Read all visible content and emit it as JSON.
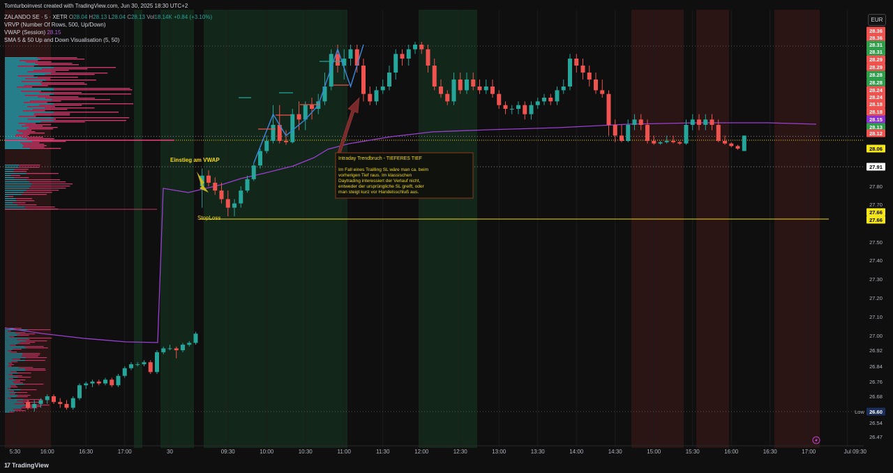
{
  "credit": "Tomturboinvest created with TradingView.com, Jun 30, 2025 18:30 UTC+2",
  "symbol_line": {
    "name": "ZALANDO SE · 5 · XETR",
    "o_label": "O",
    "o": "28.04",
    "h_label": "H",
    "h": "28.13",
    "l_label": "L",
    "l": "28.04",
    "c_label": "C",
    "c": "28.13",
    "vol_label": "Vol",
    "vol": "18.14K",
    "change": "+0.84 (+3.10%)"
  },
  "indicators": [
    {
      "label": "VRVP (Number Of Rows, 500, Up/Down)",
      "value": ""
    },
    {
      "label": "VWAP (Session)",
      "value": "28.15"
    },
    {
      "label": "SMA 5 & 50 Up and Down Visualisation (5, 50)",
      "value": ""
    }
  ],
  "currency": "EUR",
  "brand": "TradingView",
  "brand_logo": "17",
  "colors": {
    "up": "#26a69a",
    "down": "#ef5350",
    "vwap": "#9c3fd1",
    "vp_up": "#26c6da",
    "vp_down": "#ec407a",
    "annotation": "#f5d90a",
    "bg_green": "#13261a",
    "bg_red": "#2a1414",
    "sl_line": "#f5d90a"
  },
  "annotations": {
    "entry": "Einstieg am VWAP",
    "stoploss": "StopLoss",
    "box_title": "Intraday Trendbruch - TIEFERES TIEF",
    "box_text": "Im Fall eines Trailling SL wäre man ca. beim vorherigen Tief raus. Im klassischen Daytrading interessiert der Verlauf nicht, entweder der ursprüngliche SL greift, oder man steigt kurz vor Handelsschluß aus."
  },
  "chart_data": {
    "type": "candlestick",
    "symbol": "ZALANDO SE",
    "interval": "5",
    "exchange": "XETR",
    "y_ticks": [
      "28.36",
      "28.36",
      "28.31",
      "28.31",
      "28.29",
      "28.29",
      "28.28",
      "28.28",
      "28.24",
      "28.24",
      "28.18",
      "28.18",
      "28.15",
      "28.13",
      "28.12",
      "28.06",
      "27.91",
      "27.80",
      "27.70",
      "27.66",
      "27.66",
      "27.50",
      "27.40",
      "27.30",
      "27.20",
      "27.10",
      "27.00",
      "26.92",
      "26.84",
      "26.76",
      "26.68",
      "26.60",
      "26.54",
      "26.47"
    ],
    "y_tick_values": [
      28.36,
      28.36,
      28.31,
      28.31,
      28.29,
      28.29,
      28.28,
      28.28,
      28.24,
      28.24,
      28.18,
      28.18,
      28.15,
      28.13,
      28.12,
      28.06,
      27.91,
      27.8,
      27.7,
      27.66,
      27.66,
      27.5,
      27.4,
      27.3,
      27.2,
      27.1,
      27.0,
      26.92,
      26.84,
      26.76,
      26.68,
      26.6,
      26.54,
      26.47
    ],
    "y_tick_styles": [
      "down",
      "down",
      "up",
      "up",
      "down",
      "down",
      "up",
      "up",
      "down",
      "down",
      "down",
      "down",
      "vwap",
      "up",
      "down",
      "yellow",
      "white",
      "plain",
      "plain",
      "yellow",
      "yellow",
      "plain",
      "plain",
      "plain",
      "plain",
      "plain",
      "plain",
      "plain",
      "plain",
      "plain",
      "plain",
      "low",
      "plain",
      "plain"
    ],
    "low_label": "Low",
    "x_ticks": [
      "5:30",
      "16:00",
      "16:30",
      "17:00",
      "30",
      "09:30",
      "10:00",
      "10:30",
      "11:00",
      "11:30",
      "12:00",
      "12:30",
      "13:00",
      "13:30",
      "14:00",
      "14:30",
      "15:00",
      "15:30",
      "16:00",
      "16:30",
      "17:00",
      "Jul",
      "09:30"
    ],
    "x_tick_index": [
      -2,
      3,
      9,
      15,
      22,
      31,
      37,
      43,
      49,
      55,
      61,
      67,
      73,
      79,
      85,
      91,
      97,
      103,
      109,
      115,
      121,
      127,
      133
    ],
    "ohlc": [
      [
        26.65,
        26.66,
        26.61,
        26.62
      ],
      [
        26.62,
        26.66,
        26.6,
        26.64
      ],
      [
        26.64,
        26.67,
        26.62,
        26.66
      ],
      [
        26.66,
        26.69,
        26.64,
        26.68
      ],
      [
        26.68,
        26.69,
        26.64,
        26.65
      ],
      [
        26.65,
        26.67,
        26.62,
        26.64
      ],
      [
        26.64,
        26.66,
        26.61,
        26.62
      ],
      [
        26.62,
        26.68,
        26.61,
        26.67
      ],
      [
        26.67,
        26.75,
        26.66,
        26.74
      ],
      [
        26.74,
        26.76,
        26.72,
        26.75
      ],
      [
        26.75,
        26.77,
        26.73,
        26.76
      ],
      [
        26.76,
        26.77,
        26.74,
        26.75
      ],
      [
        26.75,
        26.78,
        26.74,
        26.77
      ],
      [
        26.77,
        26.78,
        26.73,
        26.74
      ],
      [
        26.74,
        26.8,
        26.73,
        26.79
      ],
      [
        26.79,
        26.84,
        26.78,
        26.83
      ],
      [
        26.83,
        26.86,
        26.82,
        26.85
      ],
      [
        26.85,
        26.86,
        26.84,
        26.85
      ],
      [
        26.85,
        26.87,
        26.84,
        26.86
      ],
      [
        26.86,
        26.87,
        26.8,
        26.81
      ],
      [
        26.81,
        26.92,
        26.8,
        26.91
      ],
      [
        26.91,
        26.94,
        26.9,
        26.93
      ],
      [
        26.93,
        26.95,
        26.92,
        26.93
      ],
      [
        26.93,
        26.94,
        26.88,
        26.92
      ],
      [
        26.92,
        26.96,
        26.91,
        26.95
      ],
      [
        26.95,
        26.97,
        26.94,
        26.96
      ],
      [
        26.96,
        27.02,
        26.95,
        27.01
      ],
      [
        27.8,
        27.9,
        27.7,
        27.86
      ],
      [
        27.86,
        27.89,
        27.8,
        27.82
      ],
      [
        27.82,
        27.85,
        27.76,
        27.78
      ],
      [
        27.78,
        27.82,
        27.72,
        27.74
      ],
      [
        27.74,
        27.78,
        27.66,
        27.7
      ],
      [
        27.7,
        27.74,
        27.66,
        27.72
      ],
      [
        27.72,
        27.8,
        27.7,
        27.78
      ],
      [
        27.78,
        27.86,
        27.77,
        27.84
      ],
      [
        27.84,
        27.94,
        27.83,
        27.92
      ],
      [
        27.92,
        28.06,
        27.9,
        28.04
      ],
      [
        28.04,
        28.13,
        28.02,
        28.12
      ],
      [
        28.12,
        28.19,
        28.1,
        28.15
      ],
      [
        28.15,
        28.19,
        28.1,
        28.12
      ],
      [
        28.12,
        28.14,
        28.09,
        28.11
      ],
      [
        28.11,
        28.18,
        28.1,
        28.17
      ],
      [
        28.17,
        28.2,
        28.14,
        28.16
      ],
      [
        28.16,
        28.2,
        28.14,
        28.19
      ],
      [
        28.19,
        28.21,
        28.16,
        28.18
      ],
      [
        28.18,
        28.22,
        28.17,
        28.2
      ],
      [
        28.2,
        28.26,
        28.19,
        28.24
      ],
      [
        28.24,
        28.3,
        28.23,
        28.29
      ],
      [
        28.29,
        28.31,
        28.26,
        28.27
      ],
      [
        28.27,
        28.3,
        28.25,
        28.28
      ],
      [
        28.28,
        28.31,
        28.27,
        28.3
      ],
      [
        28.3,
        28.31,
        28.26,
        28.27
      ],
      [
        28.27,
        28.28,
        28.2,
        28.22
      ],
      [
        28.22,
        28.24,
        28.19,
        28.2
      ],
      [
        28.2,
        28.24,
        28.19,
        28.23
      ],
      [
        28.23,
        28.25,
        28.22,
        28.24
      ],
      [
        28.24,
        28.27,
        28.23,
        28.26
      ],
      [
        28.26,
        28.3,
        28.25,
        28.29
      ],
      [
        28.29,
        28.3,
        28.27,
        28.28
      ],
      [
        28.28,
        28.31,
        28.27,
        28.3
      ],
      [
        28.3,
        28.32,
        28.29,
        28.31
      ],
      [
        28.31,
        28.32,
        28.29,
        28.3
      ],
      [
        28.3,
        28.31,
        28.26,
        28.27
      ],
      [
        28.27,
        28.28,
        28.23,
        28.24
      ],
      [
        28.24,
        28.25,
        28.21,
        28.22
      ],
      [
        28.22,
        28.23,
        28.19,
        28.2
      ],
      [
        28.2,
        28.26,
        28.19,
        28.25
      ],
      [
        28.25,
        28.26,
        28.22,
        28.23
      ],
      [
        28.23,
        28.26,
        28.22,
        28.25
      ],
      [
        28.25,
        28.26,
        28.23,
        28.24
      ],
      [
        28.24,
        28.25,
        28.22,
        28.23
      ],
      [
        28.23,
        28.25,
        28.22,
        28.24
      ],
      [
        28.24,
        28.25,
        28.21,
        28.22
      ],
      [
        28.22,
        28.23,
        28.18,
        28.19
      ],
      [
        28.19,
        28.2,
        28.17,
        28.18
      ],
      [
        28.18,
        28.19,
        28.17,
        28.18
      ],
      [
        28.18,
        28.2,
        28.17,
        28.19
      ],
      [
        28.19,
        28.2,
        28.16,
        28.17
      ],
      [
        28.17,
        28.2,
        28.16,
        28.19
      ],
      [
        28.19,
        28.21,
        28.18,
        28.2
      ],
      [
        28.2,
        28.22,
        28.19,
        28.21
      ],
      [
        28.21,
        28.22,
        28.19,
        28.2
      ],
      [
        28.2,
        28.24,
        28.19,
        28.23
      ],
      [
        28.23,
        28.25,
        28.22,
        28.24
      ],
      [
        28.24,
        28.29,
        28.23,
        28.28
      ],
      [
        28.28,
        28.29,
        28.26,
        28.27
      ],
      [
        28.27,
        28.28,
        28.25,
        28.26
      ],
      [
        28.26,
        28.27,
        28.24,
        28.25
      ],
      [
        28.25,
        28.26,
        28.22,
        28.23
      ],
      [
        28.23,
        28.25,
        28.21,
        28.22
      ],
      [
        28.22,
        28.23,
        28.13,
        28.15
      ],
      [
        28.15,
        28.16,
        28.11,
        28.13
      ],
      [
        28.13,
        28.15,
        28.11,
        28.12
      ],
      [
        28.12,
        28.16,
        28.11,
        28.15
      ],
      [
        28.15,
        28.17,
        28.14,
        28.16
      ],
      [
        28.16,
        28.17,
        28.14,
        28.15
      ],
      [
        28.15,
        28.16,
        28.1,
        28.12
      ],
      [
        28.12,
        28.13,
        28.09,
        28.1
      ],
      [
        28.1,
        28.12,
        28.09,
        28.11
      ],
      [
        28.11,
        28.13,
        28.1,
        28.12
      ],
      [
        28.12,
        28.13,
        28.1,
        28.11
      ],
      [
        28.11,
        28.12,
        28.09,
        28.1
      ],
      [
        28.1,
        28.16,
        28.09,
        28.15
      ],
      [
        28.15,
        28.17,
        28.14,
        28.16
      ],
      [
        28.16,
        28.17,
        28.14,
        28.15
      ],
      [
        28.15,
        28.17,
        28.14,
        28.16
      ],
      [
        28.16,
        28.17,
        28.14,
        28.15
      ],
      [
        28.15,
        28.16,
        28.11,
        28.12
      ],
      [
        28.12,
        28.13,
        28.09,
        28.1
      ],
      [
        28.1,
        28.11,
        28.07,
        28.08
      ],
      [
        28.08,
        28.09,
        28.05,
        28.06
      ],
      [
        28.04,
        28.13,
        28.04,
        28.13
      ]
    ]
  }
}
